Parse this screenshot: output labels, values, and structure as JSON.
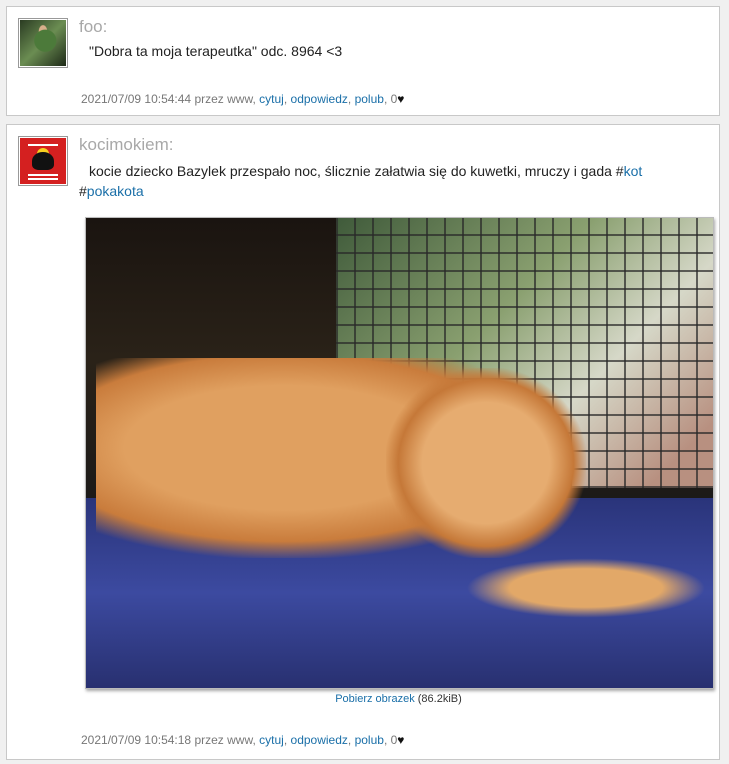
{
  "posts": [
    {
      "username": "foo:",
      "text": "\"Dobra ta moja terapeutka\" odc. 8964 <3",
      "meta": {
        "timestamp": "2021/07/09 10:54:44",
        "by": "przez www,",
        "quote": "cytuj",
        "reply": "odpowiedz",
        "like": "polub",
        "likes": "0",
        "heart": "♥"
      }
    },
    {
      "username": "kocimokiem:",
      "text": "kocie dziecko Bazylek przespało noc, ślicznie załatwia się do kuwetki, mruczy i gada #",
      "tag1": "kot",
      "hash2": "#",
      "tag2": "pokakota",
      "image": {
        "download_label": "Pobierz obrazek",
        "size": "(86.2kiB)"
      },
      "meta": {
        "timestamp": "2021/07/09 10:54:18",
        "by": "przez www,",
        "quote": "cytuj",
        "reply": "odpowiedz",
        "like": "polub",
        "likes": "0",
        "heart": "♥"
      }
    }
  ]
}
